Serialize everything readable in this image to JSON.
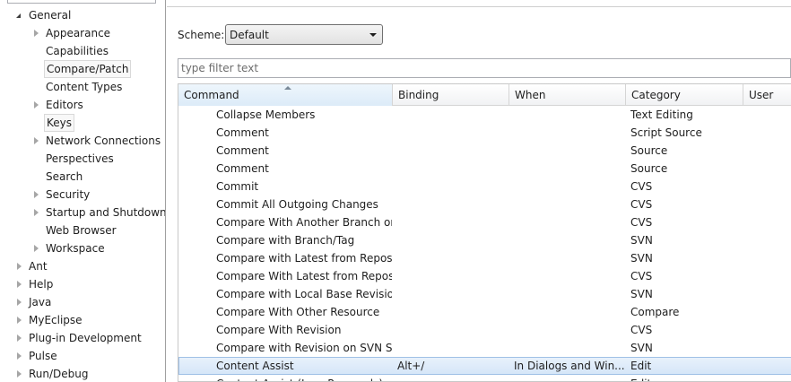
{
  "tree": {
    "items": [
      {
        "label": "General",
        "depth": 0,
        "expander": "open"
      },
      {
        "label": "Appearance",
        "depth": 1,
        "expander": "closed"
      },
      {
        "label": "Capabilities",
        "depth": 1,
        "expander": "none"
      },
      {
        "label": "Compare/Patch",
        "depth": 1,
        "expander": "none",
        "highlight": true
      },
      {
        "label": "Content Types",
        "depth": 1,
        "expander": "none"
      },
      {
        "label": "Editors",
        "depth": 1,
        "expander": "closed"
      },
      {
        "label": "Keys",
        "depth": 1,
        "expander": "none",
        "selected": true
      },
      {
        "label": "Network Connections",
        "depth": 1,
        "expander": "closed"
      },
      {
        "label": "Perspectives",
        "depth": 1,
        "expander": "none"
      },
      {
        "label": "Search",
        "depth": 1,
        "expander": "none"
      },
      {
        "label": "Security",
        "depth": 1,
        "expander": "closed"
      },
      {
        "label": "Startup and Shutdown",
        "depth": 1,
        "expander": "closed"
      },
      {
        "label": "Web Browser",
        "depth": 1,
        "expander": "none"
      },
      {
        "label": "Workspace",
        "depth": 1,
        "expander": "closed"
      },
      {
        "label": "Ant",
        "depth": 0,
        "expander": "closed"
      },
      {
        "label": "Help",
        "depth": 0,
        "expander": "closed"
      },
      {
        "label": "Java",
        "depth": 0,
        "expander": "closed"
      },
      {
        "label": "MyEclipse",
        "depth": 0,
        "expander": "closed"
      },
      {
        "label": "Plug-in Development",
        "depth": 0,
        "expander": "closed"
      },
      {
        "label": "Pulse",
        "depth": 0,
        "expander": "closed"
      },
      {
        "label": "Run/Debug",
        "depth": 0,
        "expander": "closed"
      }
    ]
  },
  "scheme": {
    "label": "Scheme:",
    "value": "Default"
  },
  "filter": {
    "placeholder": "type filter text",
    "value": ""
  },
  "table": {
    "columns": [
      {
        "label": "Command"
      },
      {
        "label": "Binding"
      },
      {
        "label": "When"
      },
      {
        "label": "Category"
      },
      {
        "label": "User"
      }
    ],
    "rows": [
      {
        "command": "Collapse Members",
        "binding": "",
        "when": "",
        "category": "Text Editing",
        "user": ""
      },
      {
        "command": "Comment",
        "binding": "",
        "when": "",
        "category": "Script Source",
        "user": ""
      },
      {
        "command": "Comment",
        "binding": "",
        "when": "",
        "category": "Source",
        "user": ""
      },
      {
        "command": "Comment",
        "binding": "",
        "when": "",
        "category": "Source",
        "user": ""
      },
      {
        "command": "Commit",
        "binding": "",
        "when": "",
        "category": "CVS",
        "user": ""
      },
      {
        "command": "Commit All Outgoing Changes",
        "binding": "",
        "when": "",
        "category": "CVS",
        "user": ""
      },
      {
        "command": "Compare With Another Branch or Version",
        "binding": "",
        "when": "",
        "category": "CVS",
        "user": ""
      },
      {
        "command": "Compare with Branch/Tag",
        "binding": "",
        "when": "",
        "category": "SVN",
        "user": ""
      },
      {
        "command": "Compare with Latest from Repository",
        "binding": "",
        "when": "",
        "category": "SVN",
        "user": ""
      },
      {
        "command": "Compare With Latest from Repository",
        "binding": "",
        "when": "",
        "category": "CVS",
        "user": ""
      },
      {
        "command": "Compare with Local Base Revision",
        "binding": "",
        "when": "",
        "category": "SVN",
        "user": ""
      },
      {
        "command": "Compare With Other Resource",
        "binding": "",
        "when": "",
        "category": "Compare",
        "user": ""
      },
      {
        "command": "Compare With Revision",
        "binding": "",
        "when": "",
        "category": "CVS",
        "user": ""
      },
      {
        "command": "Compare with Revision on SVN Server",
        "binding": "",
        "when": "",
        "category": "SVN",
        "user": ""
      },
      {
        "command": "Content Assist",
        "binding": "Alt+/",
        "when": "In Dialogs and Win...",
        "category": "Edit",
        "user": "",
        "selected": true
      },
      {
        "command": "Content Assist (Java Proposals)",
        "binding": "",
        "when": "",
        "category": "Edit",
        "user": ""
      }
    ]
  },
  "colors": {
    "selection": "#d6e6f8",
    "selection_border": "#9fc0e6"
  }
}
